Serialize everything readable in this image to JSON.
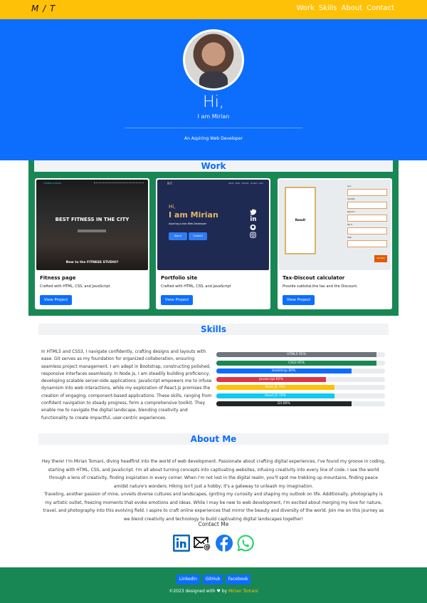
{
  "nav": {
    "brand": "M / T",
    "links": [
      "Work",
      "Skills",
      "About",
      "Contact"
    ]
  },
  "hero": {
    "greeting": "Hi,",
    "name_line": "I am Mirian",
    "tagline": "An Aspiring Web Developer"
  },
  "work": {
    "title": "Work",
    "cards": [
      {
        "title": "Fitness page",
        "text": "Crafted with HTML, CSS, and JavaScript",
        "button": "View Project",
        "preview": {
          "logo": "FITNESS STUDIO",
          "headline": "BEST FITNESS IN THE CITY",
          "footer": "New to the FITNESS STUDIO?"
        }
      },
      {
        "title": "Portfolio site",
        "text": "Crafted with HTML, CSS, and JavaScript",
        "button": "View Project",
        "preview": {
          "greeting": "Hi,",
          "name": "I am Mirian",
          "subtitle": "Aspiring Junior Web Developer",
          "btn1": "About",
          "btn2": "Contact"
        }
      },
      {
        "title": "Tax-Discout calculator",
        "text": "Provide subtotal,the tax and the Discount.",
        "button": "View Project",
        "preview": {
          "receipt": "Result",
          "labels": [
            "Sum",
            "Quantity",
            "Result %",
            "Tax %",
            "Total"
          ],
          "calc": "Get Total"
        }
      }
    ]
  },
  "skills": {
    "title": "Skills",
    "text": "In HTML5 and CSS3, I navigate confidently, crafting designs and layouts with ease. Git serves as my foundation for organized collaboration, ensuring seamless project management. I am adept in Bootstrap, constructing polished, responsive interfaces seamlessly. In Node.js, I am steadily building proficiency, developing scalable server-side applications. JavaScript empowers me to infuse dynamism into web interactions, while my exploration of React.js promises the creation of engaging, component-based applications. These skills, ranging from confident navigation to steady progress, form a comprehensive toolkit. They enable me to navigate the digital landscape, blending creativity and functionality to create impactful, user-centric experiences.",
    "bars": [
      {
        "label": "HTML5 95%",
        "value": 95,
        "color": "#6c757d"
      },
      {
        "label": "CSS3 95%",
        "value": 95,
        "color": "#198754"
      },
      {
        "label": "bootstrap 80%",
        "value": 80,
        "color": "#0d6efd"
      },
      {
        "label": "Javascript 65%",
        "value": 65,
        "color": "#dc3545"
      },
      {
        "label": "Node JS 70%",
        "value": 70,
        "color": "#ffc107"
      },
      {
        "label": "React JS 70%",
        "value": 70,
        "color": "#0dcaf0"
      },
      {
        "label": "Git 80%",
        "value": 80,
        "color": "#212529"
      }
    ]
  },
  "about": {
    "title": "About Me",
    "p1": "Hey there! I'm Mirian Tomani, diving headfirst into the world of web development. Passionate about crafting digital experiences, I've found my groove in coding, starting with HTML, CSS, and JavaScript. I'm all about turning concepts into captivating websites, infusing creativity into every line of code. I see the world through a lens of creativity, finding inspiration in every corner. When I'm not lost in the digital realm, you'll spot me trekking up mountains, finding peace amidst nature's wonders. Hiking isn't just a hobby; it's a gateway to unleash my imagination.",
    "p2": "Traveling, another passion of mine, unveils diverse cultures and landscapes, igniting my curiosity and shaping my outlook on life. Additionally, photography is my artistic outlet, freezing moments that evoke emotions and ideas. While I may be new to web development, I'm excited about merging my love for nature, travel, and photography into this evolving field. I aspire to craft online experiences that mirror the beauty and diversity of the world. Join me on this journey as we blend creativity and technology to build captivating digital landscapes together!",
    "contact_title": "Contact Me",
    "contact_icons": [
      "linkedin-icon",
      "email-icon",
      "facebook-icon",
      "whatsapp-icon"
    ],
    "contact_labels": [
      "in",
      "@",
      "f",
      "✆"
    ]
  },
  "footer": {
    "buttons": [
      "LinkedIn",
      "GitHub",
      "Facebook"
    ],
    "copy_prefix": "©2023 designed with ♥ by ",
    "author": "Mirian Tomani"
  },
  "colors": {
    "primary": "#0d6efd",
    "accent": "#ffc107",
    "success": "#198754"
  }
}
